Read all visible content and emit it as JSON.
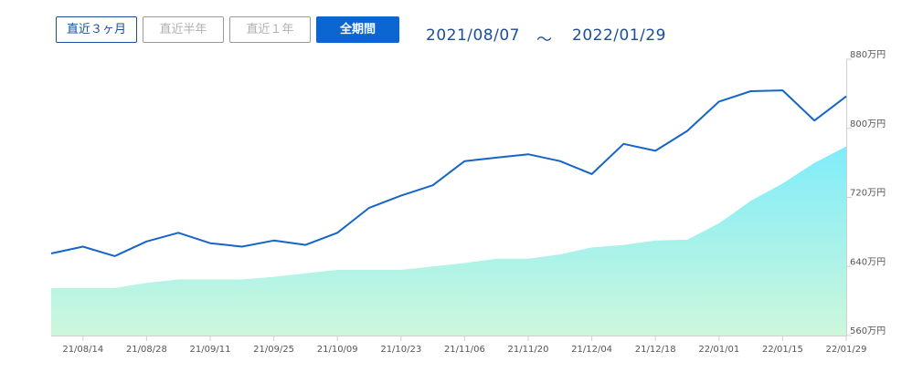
{
  "period_tabs": [
    {
      "label": "直近３ヶ月",
      "state": "outlined"
    },
    {
      "label": "直近半年",
      "state": "inactive"
    },
    {
      "label": "直近１年",
      "state": "inactive"
    },
    {
      "label": "全期間",
      "state": "active"
    }
  ],
  "date_range": {
    "start": "2021/08/07",
    "separator": "～",
    "end": "2022/01/29"
  },
  "colors": {
    "line": "#1565c8",
    "area_top": "#7fecfa",
    "area_bottom": "#cdf7dc",
    "accent": "#0b66d1"
  },
  "chart_data": {
    "type": "area",
    "y_unit": "万円",
    "y_ticks": [
      "880万円",
      "800万円",
      "720万円",
      "640万円",
      "560万円"
    ],
    "y_tick_values": [
      880,
      800,
      720,
      640,
      560
    ],
    "ylim": [
      560,
      880
    ],
    "x_ticks": [
      "21/08/14",
      "21/08/28",
      "21/09/11",
      "21/09/25",
      "21/10/09",
      "21/10/23",
      "21/11/06",
      "21/11/20",
      "21/12/04",
      "21/12/18",
      "22/01/01",
      "22/01/15",
      "22/01/29"
    ],
    "x": [
      "21/08/07",
      "21/08/14",
      "21/08/21",
      "21/08/28",
      "21/09/04",
      "21/09/11",
      "21/09/18",
      "21/09/25",
      "21/10/02",
      "21/10/09",
      "21/10/16",
      "21/10/23",
      "21/10/30",
      "21/11/06",
      "21/11/13",
      "21/11/20",
      "21/11/27",
      "21/12/04",
      "21/12/11",
      "21/12/18",
      "21/12/25",
      "22/01/01",
      "22/01/08",
      "22/01/15",
      "22/01/22",
      "22/01/29"
    ],
    "series": [
      {
        "kind": "line",
        "values": [
          655,
          663,
          652,
          669,
          679,
          667,
          663,
          670,
          665,
          679,
          708,
          722,
          734,
          762,
          766,
          770,
          762,
          747,
          782,
          774,
          797,
          831,
          843,
          844,
          809,
          837
        ]
      },
      {
        "kind": "area",
        "values": [
          615,
          615,
          615,
          621,
          625,
          625,
          625,
          628,
          632,
          636,
          636,
          636,
          640,
          644,
          649,
          649,
          654,
          662,
          665,
          670,
          671,
          690,
          716,
          736,
          760,
          779
        ]
      }
    ],
    "grid": false
  }
}
